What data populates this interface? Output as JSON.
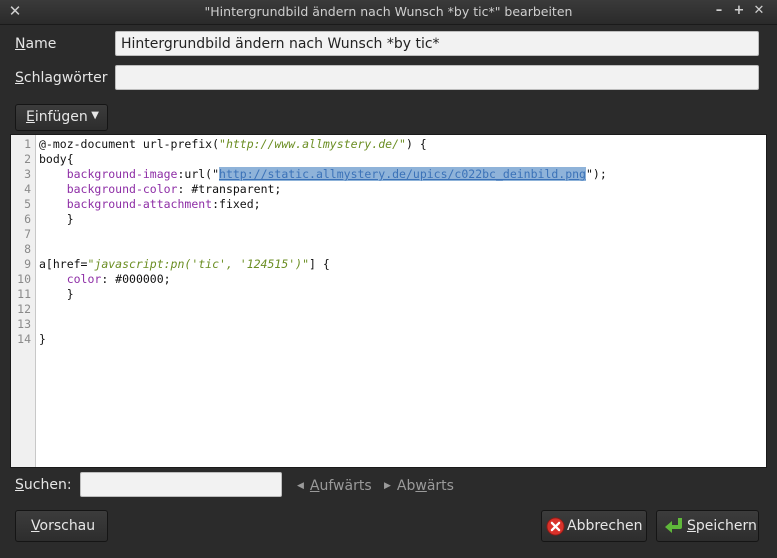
{
  "window": {
    "title": "\"Hintergrundbild ändern nach Wunsch *by tic*\" bearbeiten"
  },
  "form": {
    "name_label_first": "N",
    "name_label_rest": "ame",
    "name_value": "Hintergrundbild ändern nach Wunsch *by tic*",
    "tags_label_first": "S",
    "tags_label_rest": "chlagwörter",
    "tags_value": ""
  },
  "insert_button": {
    "label_first": "E",
    "label_rest": "infügen"
  },
  "editor": {
    "line_numbers": [
      "1",
      "2",
      "3",
      "4",
      "5",
      "6",
      "7",
      "8",
      "9",
      "10",
      "11",
      "12",
      "13",
      "14"
    ],
    "l1_a": "@-moz-document url-prefix(",
    "l1_str": "\"http://www.allmystery.de/\"",
    "l1_b": ") {",
    "l2": "body{",
    "l3_indent": "    ",
    "l3_prop": "background-image",
    "l3_a": ":url(\"",
    "l3_sel": "http://static.allmystery.de/upics/c022bc_deinbild.png",
    "l3_b": "\");",
    "l4_indent": "    ",
    "l4_prop": "background-color",
    "l4_a": ": #transparent;",
    "l5_indent": "    ",
    "l5_prop": "background-attachment",
    "l5_a": ":fixed;",
    "l6": "    }",
    "l9_a": "a[href=",
    "l9_str": "\"javascript:pn('tic', '124515')\"",
    "l9_b": "] {",
    "l10_indent": "    ",
    "l10_prop": "color",
    "l10_a": ": #000000;",
    "l11": "    }",
    "l14": "}"
  },
  "search": {
    "label_first": "S",
    "label_rest": "uchen:",
    "value": "",
    "up_first": "A",
    "up_rest": "ufwärts",
    "down_pre": "Ab",
    "down_u": "w",
    "down_post": "ärts"
  },
  "buttons": {
    "preview_first": "V",
    "preview_rest": "orschau",
    "cancel_label": "Abbrechen",
    "save_first": "S",
    "save_rest": "peichern"
  },
  "colors": {
    "cancel_icon": "#d9322b",
    "save_icon": "#5fb83a",
    "selection": "#8fb3d9"
  }
}
